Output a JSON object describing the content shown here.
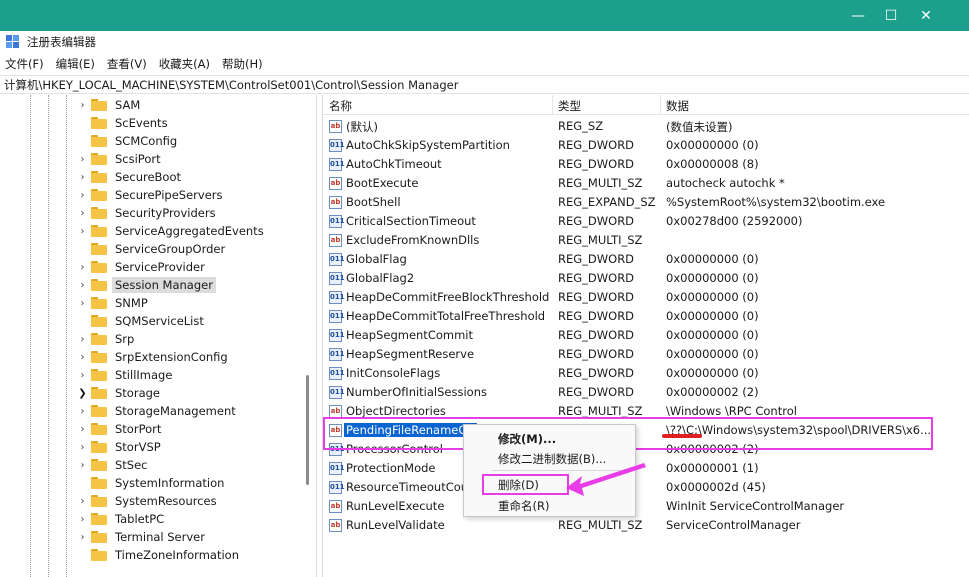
{
  "window": {
    "title": "注册表编辑器",
    "controls": {
      "minimize": "—",
      "maximize": "☐",
      "close": "✕"
    }
  },
  "menu": [
    "文件(F)",
    "编辑(E)",
    "查看(V)",
    "收藏夹(A)",
    "帮助(H)"
  ],
  "address": "计算机\\HKEY_LOCAL_MACHINE\\SYSTEM\\ControlSet001\\Control\\Session Manager",
  "tree": {
    "items": [
      {
        "label": "SAM",
        "expandable": true
      },
      {
        "label": "ScEvents",
        "expandable": false
      },
      {
        "label": "SCMConfig",
        "expandable": false
      },
      {
        "label": "ScsiPort",
        "expandable": true
      },
      {
        "label": "SecureBoot",
        "expandable": true
      },
      {
        "label": "SecurePipeServers",
        "expandable": true
      },
      {
        "label": "SecurityProviders",
        "expandable": true
      },
      {
        "label": "ServiceAggregatedEvents",
        "expandable": true
      },
      {
        "label": "ServiceGroupOrder",
        "expandable": false
      },
      {
        "label": "ServiceProvider",
        "expandable": true
      },
      {
        "label": "Session Manager",
        "expandable": true,
        "selected": true
      },
      {
        "label": "SNMP",
        "expandable": true
      },
      {
        "label": "SQMServiceList",
        "expandable": false
      },
      {
        "label": "Srp",
        "expandable": true
      },
      {
        "label": "SrpExtensionConfig",
        "expandable": true
      },
      {
        "label": "StillImage",
        "expandable": true
      },
      {
        "label": "Storage",
        "expandable": true,
        "expanded_arrow": true
      },
      {
        "label": "StorageManagement",
        "expandable": true
      },
      {
        "label": "StorPort",
        "expandable": true
      },
      {
        "label": "StorVSP",
        "expandable": true
      },
      {
        "label": "StSec",
        "expandable": true
      },
      {
        "label": "SystemInformation",
        "expandable": false
      },
      {
        "label": "SystemResources",
        "expandable": true
      },
      {
        "label": "TabletPC",
        "expandable": true
      },
      {
        "label": "Terminal Server",
        "expandable": true
      },
      {
        "label": "TimeZoneInformation",
        "expandable": false
      }
    ]
  },
  "list": {
    "headers": {
      "name": "名称",
      "type": "类型",
      "data": "数据"
    },
    "rows": [
      {
        "icon": "string-value-icon",
        "name": "(默认)",
        "type": "REG_SZ",
        "data": "(数值未设置)"
      },
      {
        "icon": "dword-value-icon",
        "name": "AutoChkSkipSystemPartition",
        "type": "REG_DWORD",
        "data": "0x00000000 (0)"
      },
      {
        "icon": "dword-value-icon",
        "name": "AutoChkTimeout",
        "type": "REG_DWORD",
        "data": "0x00000008 (8)"
      },
      {
        "icon": "string-value-icon",
        "name": "BootExecute",
        "type": "REG_MULTI_SZ",
        "data": "autocheck autochk *"
      },
      {
        "icon": "string-value-icon",
        "name": "BootShell",
        "type": "REG_EXPAND_SZ",
        "data": "%SystemRoot%\\system32\\bootim.exe"
      },
      {
        "icon": "dword-value-icon",
        "name": "CriticalSectionTimeout",
        "type": "REG_DWORD",
        "data": "0x00278d00 (2592000)"
      },
      {
        "icon": "string-value-icon",
        "name": "ExcludeFromKnownDlls",
        "type": "REG_MULTI_SZ",
        "data": ""
      },
      {
        "icon": "dword-value-icon",
        "name": "GlobalFlag",
        "type": "REG_DWORD",
        "data": "0x00000000 (0)"
      },
      {
        "icon": "dword-value-icon",
        "name": "GlobalFlag2",
        "type": "REG_DWORD",
        "data": "0x00000000 (0)"
      },
      {
        "icon": "dword-value-icon",
        "name": "HeapDeCommitFreeBlockThreshold",
        "type": "REG_DWORD",
        "data": "0x00000000 (0)"
      },
      {
        "icon": "dword-value-icon",
        "name": "HeapDeCommitTotalFreeThreshold",
        "type": "REG_DWORD",
        "data": "0x00000000 (0)"
      },
      {
        "icon": "dword-value-icon",
        "name": "HeapSegmentCommit",
        "type": "REG_DWORD",
        "data": "0x00000000 (0)"
      },
      {
        "icon": "dword-value-icon",
        "name": "HeapSegmentReserve",
        "type": "REG_DWORD",
        "data": "0x00000000 (0)"
      },
      {
        "icon": "dword-value-icon",
        "name": "InitConsoleFlags",
        "type": "REG_DWORD",
        "data": "0x00000000 (0)"
      },
      {
        "icon": "dword-value-icon",
        "name": "NumberOfInitialSessions",
        "type": "REG_DWORD",
        "data": "0x00000002 (2)"
      },
      {
        "icon": "string-value-icon",
        "name": "ObjectDirectories",
        "type": "REG_MULTI_SZ",
        "data": "\\Windows \\RPC Control"
      },
      {
        "icon": "string-value-icon",
        "name": "PendingFileRenameOperations",
        "name_shown": "PendingFileRenameOp",
        "type": "",
        "data": "\\??\\C:\\Windows\\system32\\spool\\DRIVERS\\x6...",
        "selected": true
      },
      {
        "icon": "dword-value-icon",
        "name": "ProcessorControl",
        "type": "",
        "data": "0x00000002 (2)"
      },
      {
        "icon": "dword-value-icon",
        "name": "ProtectionMode",
        "type": "",
        "data": "0x00000001 (1)"
      },
      {
        "icon": "dword-value-icon",
        "name": "ResourceTimeoutCount",
        "type": "",
        "data": "0x0000002d (45)"
      },
      {
        "icon": "string-value-icon",
        "name": "RunLevelExecute",
        "type": "",
        "data": "WinInit ServiceControlManager"
      },
      {
        "icon": "string-value-icon",
        "name": "RunLevelValidate",
        "type": "REG_MULTI_SZ",
        "data": "ServiceControlManager"
      }
    ]
  },
  "context_menu": {
    "items": [
      {
        "label": "修改(M)...",
        "bold": true
      },
      {
        "label": "修改二进制数据(B)..."
      },
      {
        "label": "删除(D)"
      },
      {
        "label": "重命名(R)"
      }
    ]
  },
  "colors": {
    "topbar": "#1c9f8c",
    "selection": "#0a64d2",
    "annotation_magenta": "#e83ce6",
    "annotation_red": "#e02020"
  }
}
